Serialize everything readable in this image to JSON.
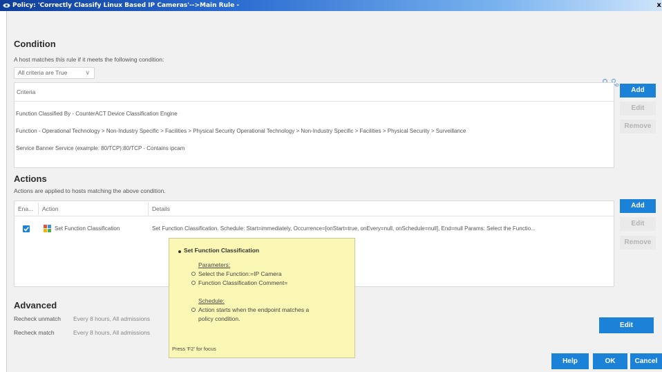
{
  "window": {
    "title": "Policy: 'Correctly Classify Linux Based IP Cameras'-->Main Rule -",
    "close_glyph": "x"
  },
  "condition": {
    "heading": "Condition",
    "description": "A host matches this rule if it meets the following condition:",
    "criteria_mode": "All criteria are True",
    "criteria_header": "Criteria",
    "rows": [
      "Function Classified By - CounterACT Device Classification Engine",
      "Function - Operational Technology > Non-Industry Specific > Facilities > Physical Security Operational Technology > Non-Industry Specific > Facilities > Physical Security > Surveillance",
      "Service Banner Service (example: 80/TCP):80/TCP - Contains ipcam"
    ],
    "buttons": {
      "add": "Add",
      "edit": "Edit",
      "remove": "Remove"
    }
  },
  "actions": {
    "heading": "Actions",
    "description": "Actions are applied to hosts matching the above condition.",
    "columns": {
      "enabled": "Ena...",
      "action": "Action",
      "details": "Details"
    },
    "rows": [
      {
        "enabled": true,
        "action": "Set Function Classification",
        "details": "Set Function Classification. Schedule: Start=immediately, Occurrence=[onStart=true, onEvery=null, onSchedule=null], End=null Params: Select the Functio..."
      }
    ],
    "buttons": {
      "add": "Add",
      "edit": "Edit",
      "remove": "Remove"
    }
  },
  "tooltip": {
    "title": "Set Function Classification",
    "parameters_label": "Parameters:",
    "param_function": "Select the Function:=IP Camera",
    "param_comment": "Function Classification Comment=",
    "schedule_label": "Schedule:",
    "schedule_line1": "Action starts when the endpoint matches a",
    "schedule_line2": "policy condition.",
    "footer": "Press 'F2' for focus"
  },
  "advanced": {
    "heading": "Advanced",
    "recheck_unmatch_label": "Recheck unmatch",
    "recheck_unmatch_value": "Every 8 hours, All admissions",
    "recheck_match_label": "Recheck match",
    "recheck_match_value": "Every 8 hours, All admissions",
    "edit_button": "Edit"
  },
  "footer": {
    "help": "Help",
    "ok": "OK",
    "cancel": "Cancel"
  },
  "colors": {
    "accent": "#1b82d8",
    "tooltip_bg": "#fbf8b5",
    "titlebar": "#1c4fb0"
  }
}
